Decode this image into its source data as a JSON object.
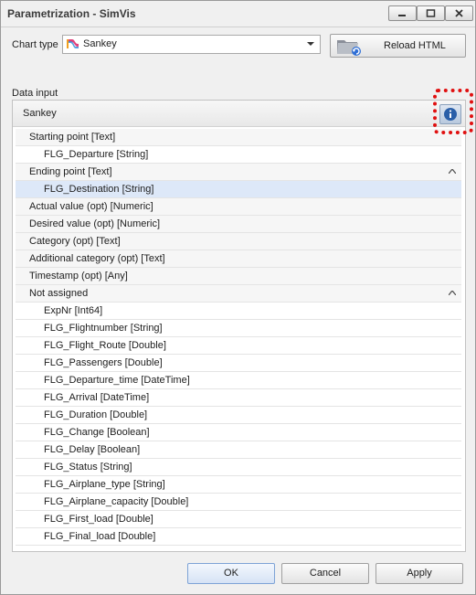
{
  "window": {
    "title": "Parametrization - SimVis"
  },
  "chart_type": {
    "label": "Chart type",
    "value": "Sankey",
    "icon": "sankey-chart-icon"
  },
  "reload_button": {
    "label": "Reload HTML",
    "icon": "folder-refresh-icon"
  },
  "data_input": {
    "label": "Data input",
    "panel_title": "Sankey",
    "info_icon": "info-icon",
    "highlight_color": "#e01010",
    "groups": [
      {
        "label": "Starting point [Text]",
        "collapsible": false,
        "items": [
          {
            "label": "FLG_Departure [String]",
            "selected": false
          }
        ]
      },
      {
        "label": "Ending point [Text]",
        "collapsible": true,
        "items": [
          {
            "label": "FLG_Destination [String]",
            "selected": true
          }
        ]
      },
      {
        "label": "Actual value (opt) [Numeric]",
        "collapsible": false,
        "items": []
      },
      {
        "label": "Desired value (opt) [Numeric]",
        "collapsible": false,
        "items": []
      },
      {
        "label": "Category (opt) [Text]",
        "collapsible": false,
        "items": []
      },
      {
        "label": "Additional category (opt) [Text]",
        "collapsible": false,
        "items": []
      },
      {
        "label": "Timestamp (opt) [Any]",
        "collapsible": false,
        "items": []
      },
      {
        "label": "Not assigned",
        "collapsible": true,
        "items": [
          {
            "label": "ExpNr [Int64]",
            "selected": false
          },
          {
            "label": "FLG_Flightnumber [String]",
            "selected": false
          },
          {
            "label": "FLG_Flight_Route [Double]",
            "selected": false
          },
          {
            "label": "FLG_Passengers [Double]",
            "selected": false
          },
          {
            "label": "FLG_Departure_time [DateTime]",
            "selected": false
          },
          {
            "label": "FLG_Arrival [DateTime]",
            "selected": false
          },
          {
            "label": "FLG_Duration [Double]",
            "selected": false
          },
          {
            "label": "FLG_Change [Boolean]",
            "selected": false
          },
          {
            "label": "FLG_Delay [Boolean]",
            "selected": false
          },
          {
            "label": "FLG_Status [String]",
            "selected": false
          },
          {
            "label": "FLG_Airplane_type [String]",
            "selected": false
          },
          {
            "label": "FLG_Airplane_capacity [Double]",
            "selected": false
          },
          {
            "label": "FLG_First_load [Double]",
            "selected": false
          },
          {
            "label": "FLG_Final_load [Double]",
            "selected": false
          }
        ]
      }
    ]
  },
  "footer": {
    "ok_label": "OK",
    "cancel_label": "Cancel",
    "apply_label": "Apply"
  }
}
